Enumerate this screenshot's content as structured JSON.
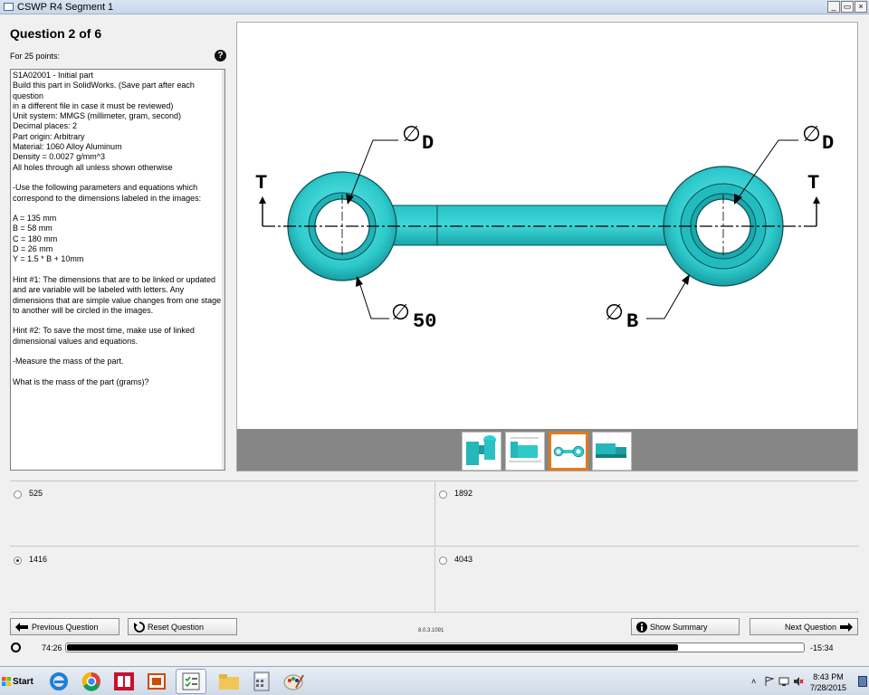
{
  "window": {
    "title": "CSWP R4 Segment 1",
    "min": "_",
    "max": "▭",
    "close": "×"
  },
  "question": {
    "title": "Question 2 of 6",
    "points": "For 25 points:",
    "help_glyph": "?",
    "text": "S1A02001 - Initial part\nBuild this part in SolidWorks. (Save part after each question\nin a different file in case it must be reviewed)\nUnit system: MMGS (millimeter, gram, second)\nDecimal places: 2\nPart origin: Arbitrary\nMaterial: 1060 Alloy Aluminum\nDensity = 0.0027 g/mm^3\nAll holes through all unless shown otherwise\n\n-Use the following parameters and equations which\ncorrespond to the dimensions labeled in the images:\n\nA = 135 mm\nB = 58 mm\nC = 180 mm\nD = 26 mm\nY = 1.5 * B + 10mm\n\nHint #1: The dimensions that are to be linked or updated\nand are variable will be labeled with letters. Any\ndimensions that are simple value changes from one stage\nto another will be circled in the images.\n\nHint #2: To save the most time, make use of linked\ndimensional values and equations.\n\n-Measure the mass of the part.\n\nWhat is the mass of the part (grams)?"
  },
  "drawing": {
    "label_d_left": "D",
    "label_d_right": "D",
    "label_t_left": "T",
    "label_t_right": "T",
    "label_50": "50",
    "label_b": "B",
    "part_color": "#2ec9cc",
    "part_dark": "#138c90"
  },
  "thumbnails": {
    "selected_index": 2,
    "selected_color": "#e07b1a"
  },
  "answers": [
    {
      "label": "525",
      "selected": false
    },
    {
      "label": "1892",
      "selected": false
    },
    {
      "label": "1416",
      "selected": true
    },
    {
      "label": "4043",
      "selected": false
    }
  ],
  "nav": {
    "previous": "Previous Question",
    "reset": "Reset Question",
    "version": "8.0.3.1091",
    "summary": "Show Summary",
    "next": "Next Question"
  },
  "timer": {
    "elapsed": "74:26",
    "remaining": "-15:34",
    "progress": 0.83
  },
  "taskbar": {
    "start": "Start",
    "time": "8:43 PM",
    "date": "7/28/2015"
  }
}
